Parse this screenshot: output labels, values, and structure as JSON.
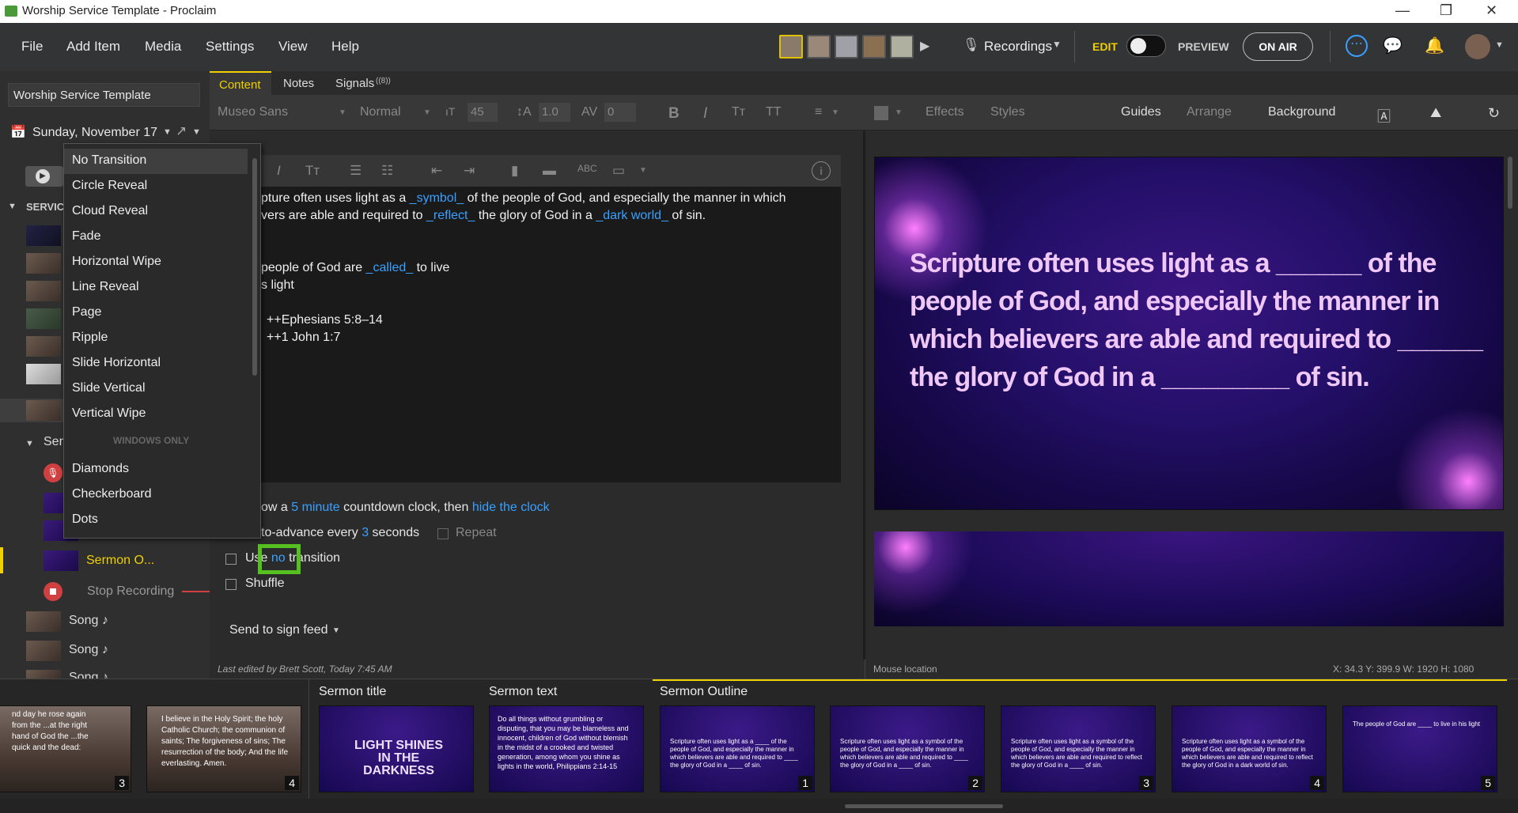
{
  "window": {
    "title": "Worship Service Template - Proclaim",
    "controls": [
      "—",
      "❐",
      "✕"
    ]
  },
  "menu": {
    "items": [
      "File",
      "Add Item",
      "Media",
      "Settings",
      "View",
      "Help"
    ]
  },
  "top": {
    "recordings": "Recordings",
    "edit": "EDIT",
    "preview": "PREVIEW",
    "on_air": "ON AIR"
  },
  "sidebar": {
    "template_name": "Worship Service Template",
    "date": "Sunday, November 17",
    "service_label": "SERVIC",
    "sermon_group": "Ser",
    "sermon_outline": "Sermon O...",
    "stop_recording": "Stop Recording",
    "songs": [
      "Song ♪",
      "Song ♪",
      "Song ♪"
    ]
  },
  "transitions": {
    "items": [
      "No Transition",
      "Circle Reveal",
      "Cloud Reveal",
      "Fade",
      "Horizontal Wipe",
      "Line Reveal",
      "Page",
      "Ripple",
      "Slide Horizontal",
      "Slide Vertical",
      "Vertical Wipe"
    ],
    "windows_only_label": "WINDOWS ONLY",
    "windows_items": [
      "Diamonds",
      "Checkerboard",
      "Dots"
    ]
  },
  "tabs": {
    "content": "Content",
    "notes": "Notes",
    "signals": "Signals",
    "signals_badge": "((8))"
  },
  "toolbar": {
    "font": "Museo Sans",
    "weight": "Normal",
    "size": "45",
    "line": "1.0",
    "spacing": "0",
    "effects": "Effects",
    "styles": "Styles",
    "guides": "Guides",
    "arrange": "Arrange",
    "background": "Background"
  },
  "editor": {
    "line1a": "pture often uses light as a ",
    "line1b": "_symbol_",
    "line1c": " of the people of God, and especially the manner in which",
    "line2a": "vers are able and required to ",
    "line2b": "_reflect_",
    "line2c": " the glory of God in a ",
    "line2d": "_dark world_",
    "line2e": " of sin.",
    "line3a": "people of God are ",
    "line3b": "_called_",
    "line3c": " to live",
    "line4": "s light",
    "line5": "++Ephesians 5:8–14",
    "line6": "++1 John 1:7"
  },
  "options": {
    "countdown_a": "ow a ",
    "countdown_b": "5 minute",
    "countdown_c": " countdown clock, then ",
    "countdown_d": "hide the clock",
    "advance_a": "to-advance every ",
    "advance_b": "3",
    "advance_c": " seconds",
    "repeat": "Repeat",
    "use_a": "Use ",
    "use_b": "no",
    "use_c": " transition",
    "shuffle": "Shuffle",
    "sign_feed": "Send to sign feed"
  },
  "preview": {
    "text": "Scripture often uses light as a ______ of the people of God, and especially the manner in which believers are able and required to ______ the glory of God in a _________ of sin."
  },
  "status": {
    "edited": "Last edited by Brett Scott, Today 7:45 AM",
    "mouse": "Mouse location",
    "coords": "X: 34.3  Y: 399.9   W: 1920  H: 1080"
  },
  "filmstrip": {
    "groups": [
      "Sermon title",
      "Sermon text",
      "Sermon Outline"
    ],
    "slides": [
      {
        "num": "3",
        "text": "nd day he rose again from the ...at the right hand of God the ...the quick and the dead:"
      },
      {
        "num": "4",
        "text": "I believe in the Holy Spirit; the holy Catholic Church; the communion of saints; The forgiveness of sins; The resurrection of the body; And the life everlasting. Amen."
      },
      {
        "num": "",
        "text": "LIGHT SHINES IN THE DARKNESS"
      },
      {
        "num": "",
        "text": "Do all things without grumbling or disputing, that you may be blameless and innocent, children of God without blemish in the midst of a crooked and twisted generation, among whom you shine as lights in the world, Philippians 2:14-15"
      },
      {
        "num": "1",
        "text": "Scripture often uses light as a ____ of the people of God, and especially the manner in which believers are able and required to ____ the glory of God in a ____ of sin."
      },
      {
        "num": "2",
        "text": "Scripture often uses light as a symbol of the people of God, and especially the manner in which believers are able and required to ____ the glory of God in a ____ of sin."
      },
      {
        "num": "3",
        "text": "Scripture often uses light as a symbol of the people of God, and especially the manner in which believers are able and required to reflect the glory of God in a ____ of sin."
      },
      {
        "num": "4",
        "text": "Scripture often uses light as a symbol of the people of God, and especially the manner in which believers are able and required to reflect the glory of God in a dark world of sin."
      },
      {
        "num": "5",
        "text": "The people of God are ____ to live in his light"
      }
    ]
  },
  "colors": {
    "accent": "#3aa0ff",
    "yellow": "#f0d000",
    "bg": "#2b2b2b",
    "highlight_box": "#55c020"
  }
}
